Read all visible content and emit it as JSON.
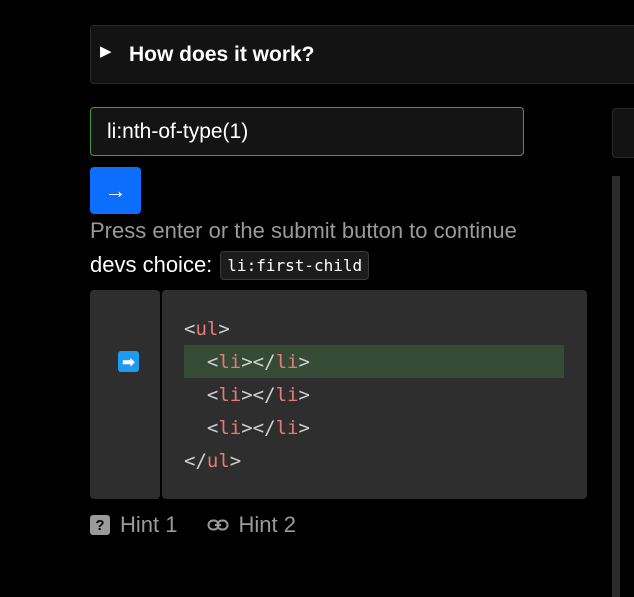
{
  "details": {
    "summary": "How does it work?"
  },
  "answer": {
    "value": "li:nth-of-type(1)"
  },
  "submit": {
    "icon": "arrow-right-icon",
    "glyph": "→"
  },
  "instructions": "Press enter or the submit button to continue",
  "devs_choice": {
    "label": "devs choice:",
    "code": "li:first-child"
  },
  "code": {
    "pointer": {
      "icon": "arrow-right-icon",
      "glyph": "➡"
    },
    "lines": [
      {
        "indent": "",
        "open": "<",
        "tag": "ul",
        "close": ">",
        "tail_open": "",
        "tail_tag": "",
        "tail_close": "",
        "highlighted": false
      },
      {
        "indent": "  ",
        "open": "<",
        "tag": "li",
        "close": "></",
        "tail_open": "",
        "tail_tag": "li",
        "tail_close": ">",
        "highlighted": true
      },
      {
        "indent": "  ",
        "open": "<",
        "tag": "li",
        "close": "></",
        "tail_open": "",
        "tail_tag": "li",
        "tail_close": ">",
        "highlighted": false
      },
      {
        "indent": "  ",
        "open": "<",
        "tag": "li",
        "close": "></",
        "tail_open": "",
        "tail_tag": "li",
        "tail_close": ">",
        "highlighted": false
      },
      {
        "indent": "",
        "open": "</",
        "tag": "ul",
        "close": ">",
        "tail_open": "",
        "tail_tag": "",
        "tail_close": "",
        "highlighted": false
      }
    ]
  },
  "hints": [
    {
      "label": "Hint 1",
      "icon": "help-icon",
      "glyph": "?"
    },
    {
      "label": "Hint 2",
      "icon": "link-icon"
    }
  ],
  "colors": {
    "background": "#000000",
    "panel": "#2e2e2e",
    "input_border": "#4a9a3a",
    "submit": "#0d6efd",
    "tag": "#e8797a",
    "highlight": "#364b36",
    "muted": "#9a9a9a"
  }
}
